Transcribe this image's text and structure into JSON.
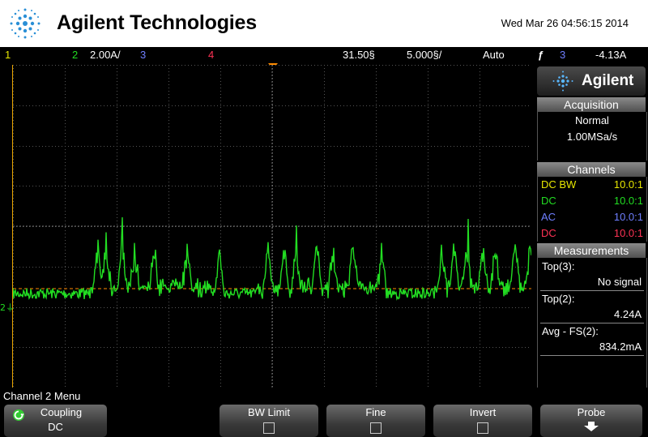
{
  "header": {
    "brand": "Agilent Technologies",
    "datetime": "Wed Mar 26 04:56:15 2014"
  },
  "status": {
    "ch1": "1",
    "ch2": "2",
    "ch2_scale": "2.00A/",
    "ch3": "3",
    "ch4": "4",
    "time_delay": "31.50§",
    "time_scale": "5.000§/",
    "trigger_mode": "Auto",
    "trigger_icon": "ƒ",
    "trigger_source": "3",
    "trigger_level": "-4.13A"
  },
  "colors": {
    "ch1": "#e6e600",
    "ch2": "#22dd22",
    "ch3": "#6f7fff",
    "ch4": "#ff3355",
    "trigger": "#ff8c00",
    "grid": "#555555"
  },
  "panel": {
    "logo_text": "Agilent",
    "acquisition_title": "Acquisition",
    "acq_mode": "Normal",
    "acq_rate": "1.00MSa/s",
    "channels_title": "Channels",
    "channels": [
      {
        "coupling": "DC BW",
        "probe": "10.0:1"
      },
      {
        "coupling": "DC",
        "probe": "10.0:1"
      },
      {
        "coupling": "AC",
        "probe": "10.0:1"
      },
      {
        "coupling": "DC",
        "probe": "10.0:1"
      }
    ],
    "measurements_title": "Measurements",
    "measurements": [
      {
        "label": "Top(3):",
        "value": "No signal"
      },
      {
        "label": "Top(2):",
        "value": "4.24A"
      },
      {
        "label": "Avg - FS(2):",
        "value": "834.2mA"
      }
    ]
  },
  "menu": {
    "title": "Channel 2 Menu",
    "coupling_label": "Coupling",
    "coupling_value": "DC",
    "bw_limit": "BW Limit",
    "fine": "Fine",
    "invert": "Invert",
    "probe": "Probe"
  },
  "markers": {
    "ch2_ground": "2"
  }
}
